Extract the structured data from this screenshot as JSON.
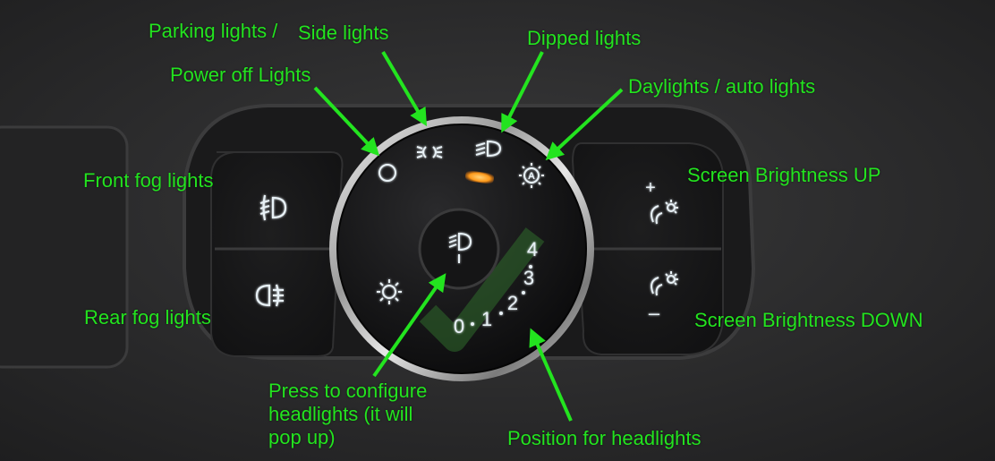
{
  "labels": {
    "parking_lights": "Parking lights /",
    "side_lights": "Side lights",
    "dipped_lights": "Dipped lights",
    "power_off_lights": "Power off Lights",
    "daylights_auto_lights": "Daylights / auto lights",
    "front_fog_lights": "Front fog lights",
    "screen_brightness_up": "Screen Brightness UP",
    "rear_fog_lights": "Rear fog lights",
    "screen_brightness_down": "Screen Brightness DOWN",
    "press_to_configure": [
      "Press to configure",
      "headlights (it will",
      "pop up)"
    ],
    "position_for_headlights": "Position for headlights"
  },
  "dial_positions": {
    "p0": "0",
    "p1": "1",
    "p2": "2",
    "p3": "3",
    "p4": "4"
  },
  "button_glyphs": {
    "plus": "+",
    "minus": "–"
  },
  "icons": [
    "power-off-icon",
    "parking-lights-icon",
    "dipped-beam-icon",
    "auto-lights-icon",
    "front-fog-icon",
    "rear-fog-icon",
    "brightness-up-icon",
    "brightness-down-icon",
    "headlight-adjust-icon",
    "sun-icon",
    "indicator-led"
  ],
  "colors": {
    "annotation": "#23e41f",
    "indicator_led": "#ff9a1a",
    "icon_glow": "#e8f1f6"
  }
}
